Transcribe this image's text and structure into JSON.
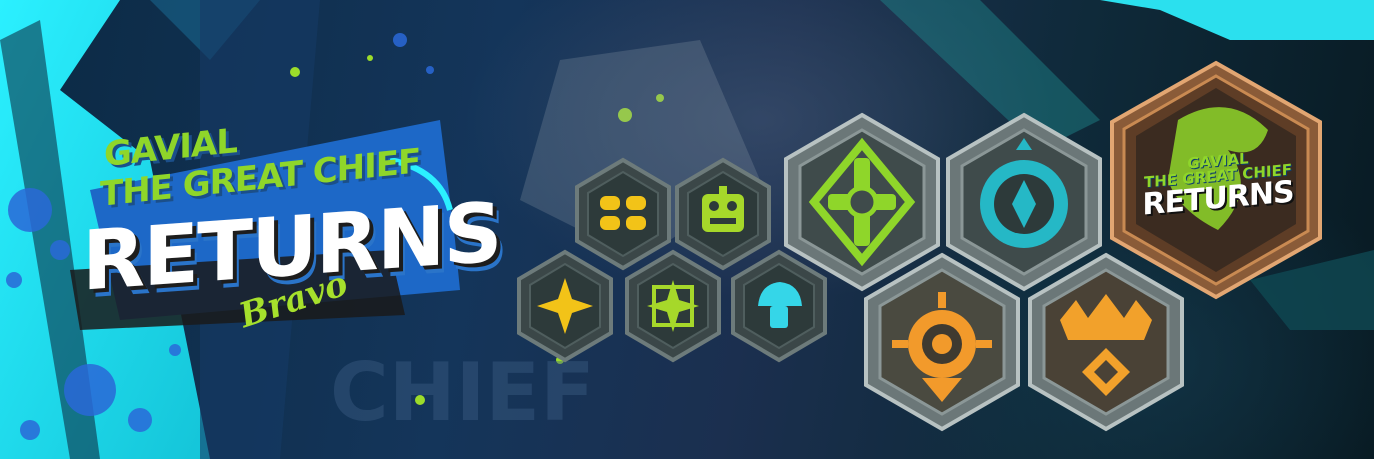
{
  "banner": {
    "title_line1": "GAVIAL",
    "title_line2": "THE GREAT CHIEF",
    "title_main": "RETURNS",
    "signature": "Bravo"
  },
  "emblem": {
    "line1": "GAVIAL",
    "line2": "THE GREAT CHIEF",
    "main": "RETURNS"
  },
  "badges": {
    "small": [
      {
        "name": "Double Coil",
        "icon": "coil-icon",
        "color": "#f2c318"
      },
      {
        "name": "Robot Head",
        "icon": "robot-head-icon",
        "color": "#a6d82a"
      },
      {
        "name": "Star Burst",
        "icon": "star-burst-icon",
        "color": "#f2c318"
      },
      {
        "name": "Cross Star",
        "icon": "cross-star-icon",
        "color": "#a6d82a"
      },
      {
        "name": "Mushroom",
        "icon": "mushroom-icon",
        "color": "#35d6e8"
      }
    ],
    "large": [
      {
        "name": "Green Cross",
        "icon": "celtic-cross-icon",
        "color": "#8fd62a"
      },
      {
        "name": "Teal Crest",
        "icon": "crest-icon",
        "color": "#25b8c6"
      },
      {
        "name": "Sun Bird",
        "icon": "sun-bird-icon",
        "color": "#f29a2b"
      },
      {
        "name": "Dragon Crown",
        "icon": "dragon-crown-icon",
        "color": "#f2a12b"
      }
    ]
  },
  "colors": {
    "cyan": "#19e3f0",
    "lime": "#8fd62a",
    "bronze": "#c98a52",
    "hex_frame": "#5d6d6e"
  }
}
